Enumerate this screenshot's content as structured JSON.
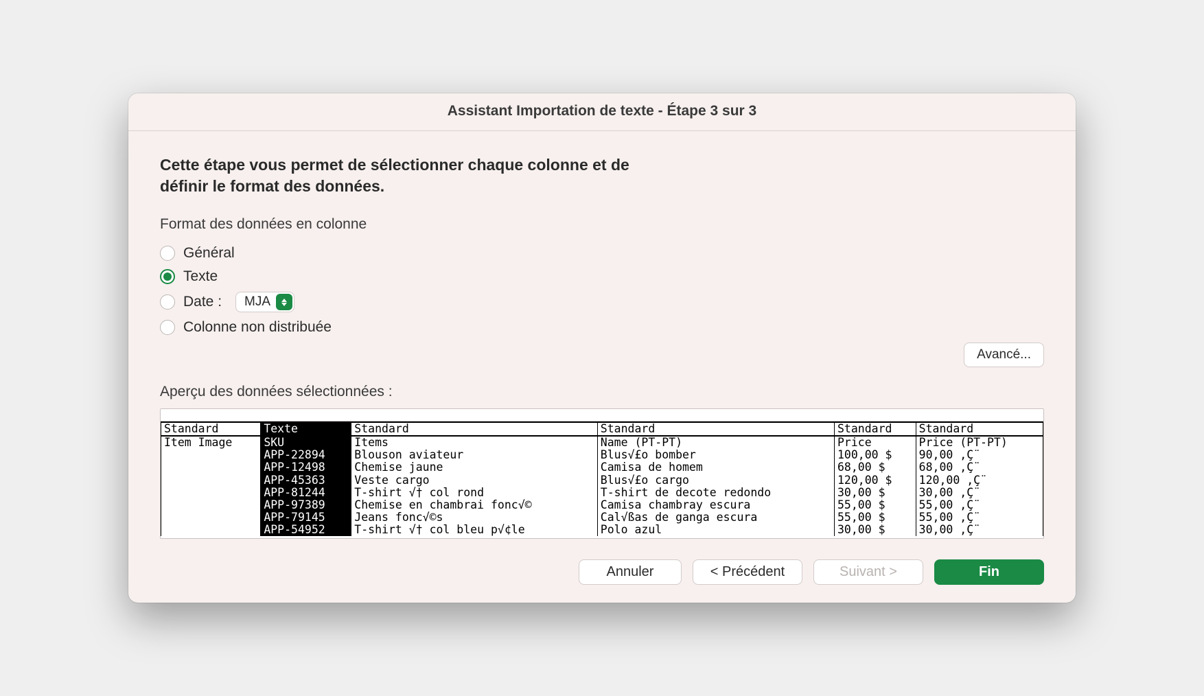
{
  "title": "Assistant Importation de texte - Étape 3 sur 3",
  "intro": "Cette étape vous permet de sélectionner chaque colonne et de définir le format des données.",
  "section_label": "Format des données en colonne",
  "radios": {
    "general": "Général",
    "text": "Texte",
    "date": "Date :",
    "skip": "Colonne non distribuée",
    "date_format": "MJA"
  },
  "advanced_btn": "Avancé...",
  "preview_label": "Aperçu des données sélectionnées :",
  "columns": [
    {
      "format": "Standard",
      "selected": false
    },
    {
      "format": "Texte",
      "selected": true
    },
    {
      "format": "Standard",
      "selected": false
    },
    {
      "format": "Standard",
      "selected": false
    },
    {
      "format": "Standard",
      "selected": false
    },
    {
      "format": "Standard",
      "selected": false
    }
  ],
  "rows": [
    [
      "Item Image",
      "SKU",
      "Items",
      "Name (PT-PT)",
      "Price",
      "Price (PT-PT)"
    ],
    [
      "",
      "APP-22894",
      "Blouson aviateur",
      "Blus√£o bomber",
      "100,00 $",
      "90,00 ‚Ç¨"
    ],
    [
      "",
      "APP-12498",
      "Chemise jaune",
      "Camisa de homem",
      "68,00 $",
      "68,00 ‚Ç¨"
    ],
    [
      "",
      "APP-45363",
      "Veste cargo",
      "Blus√£o cargo",
      "120,00 $",
      "120,00 ‚Ç¨"
    ],
    [
      "",
      "APP-81244",
      "T-shirt √† col rond",
      "T-shirt de decote redondo",
      "30,00 $",
      "30,00 ‚Ç¨"
    ],
    [
      "",
      "APP-97389",
      "Chemise en chambrai fonc√©",
      "Camisa chambray escura",
      "55,00 $",
      "55,00 ‚Ç¨"
    ],
    [
      "",
      "APP-79145",
      "Jeans fonc√©s",
      "Cal√ßas de ganga escura",
      "55,00 $",
      "55,00 ‚Ç¨"
    ],
    [
      "",
      "APP-54952",
      "T-shirt √† col bleu p√¢le",
      "Polo azul",
      "30,00 $",
      "30,00 ‚Ç¨"
    ]
  ],
  "buttons": {
    "cancel": "Annuler",
    "back": "< Précédent",
    "next": "Suivant >",
    "finish": "Fin"
  }
}
